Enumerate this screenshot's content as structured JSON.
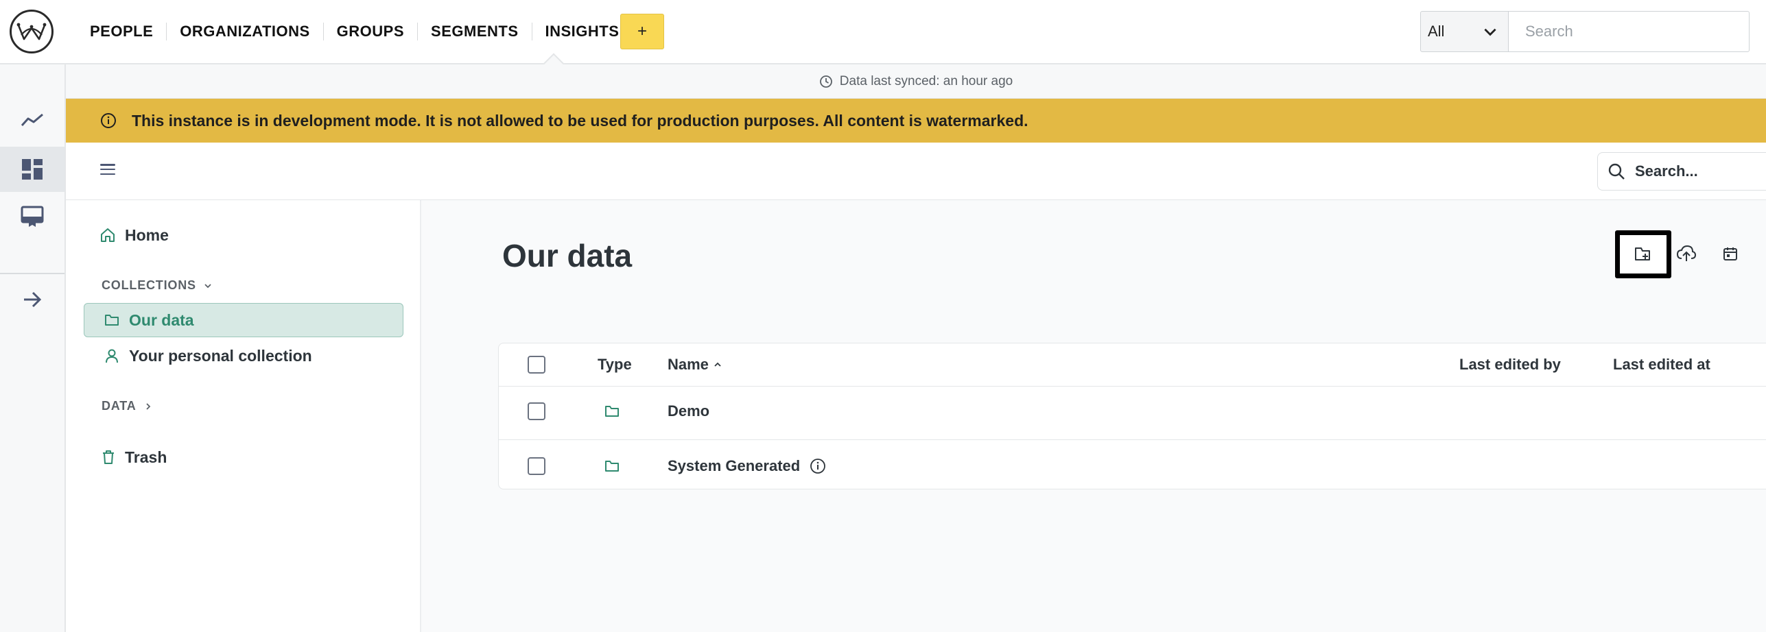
{
  "topnav": {
    "links": [
      "PEOPLE",
      "ORGANIZATIONS",
      "GROUPS",
      "SEGMENTS",
      "INSIGHTS"
    ],
    "add_label": "+",
    "scope_value": "All",
    "search_placeholder": "Search"
  },
  "sync": {
    "text": "Data last synced: an hour ago"
  },
  "banner": {
    "text": "This instance is in development mode. It is not allowed to be used for production purposes. All content is watermarked."
  },
  "toolbar": {
    "search_placeholder": "Search..."
  },
  "sidebar": {
    "home_label": "Home",
    "collections_header": "COLLECTIONS",
    "collections": [
      {
        "label": "Our data"
      },
      {
        "label": "Your personal collection"
      }
    ],
    "data_header": "DATA",
    "trash_label": "Trash"
  },
  "main": {
    "title": "Our data",
    "columns": {
      "type": "Type",
      "name": "Name",
      "last_edited_by": "Last edited by",
      "last_edited_at": "Last edited at"
    },
    "rows": [
      {
        "name": "Demo"
      },
      {
        "name": "System Generated"
      }
    ]
  },
  "colors": {
    "accent": "#509ee3",
    "brand_green": "#2f8a6f",
    "banner": "#e3b944",
    "add_button": "#f9d854"
  }
}
